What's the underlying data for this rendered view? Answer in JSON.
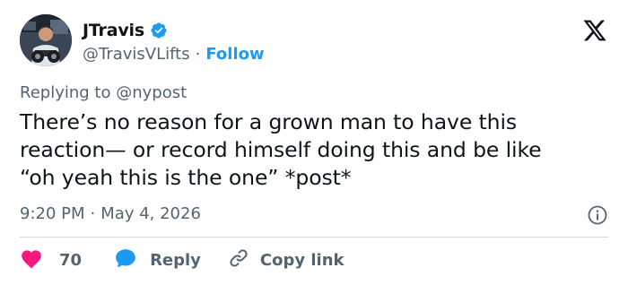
{
  "header": {
    "display_name": "JTravis",
    "handle": "@TravisVLifts",
    "separator": "·",
    "follow_label": "Follow"
  },
  "icons": {
    "verified": "verified-badge-icon",
    "platform": "x-logo-icon",
    "info": "info-icon",
    "like": "heart-icon",
    "reply": "speech-bubble-icon",
    "copy": "link-icon"
  },
  "reply_context": {
    "prefix": "Replying to",
    "mention": "@nypost"
  },
  "tweet": {
    "text": "There’s no reason for a grown man to have this\nreaction— or record himself doing this and be like\n“oh yeah this is the one” *post*"
  },
  "meta": {
    "time": "9:20 PM",
    "separator": "·",
    "date": "May 4, 2026"
  },
  "actions": {
    "like_count": "70",
    "reply_label": "Reply",
    "copy_label": "Copy link"
  },
  "colors": {
    "accent": "#1d9bf0",
    "like": "#f91880",
    "text": "#0f1419",
    "secondary": "#536471",
    "divider": "#cfd9de"
  }
}
